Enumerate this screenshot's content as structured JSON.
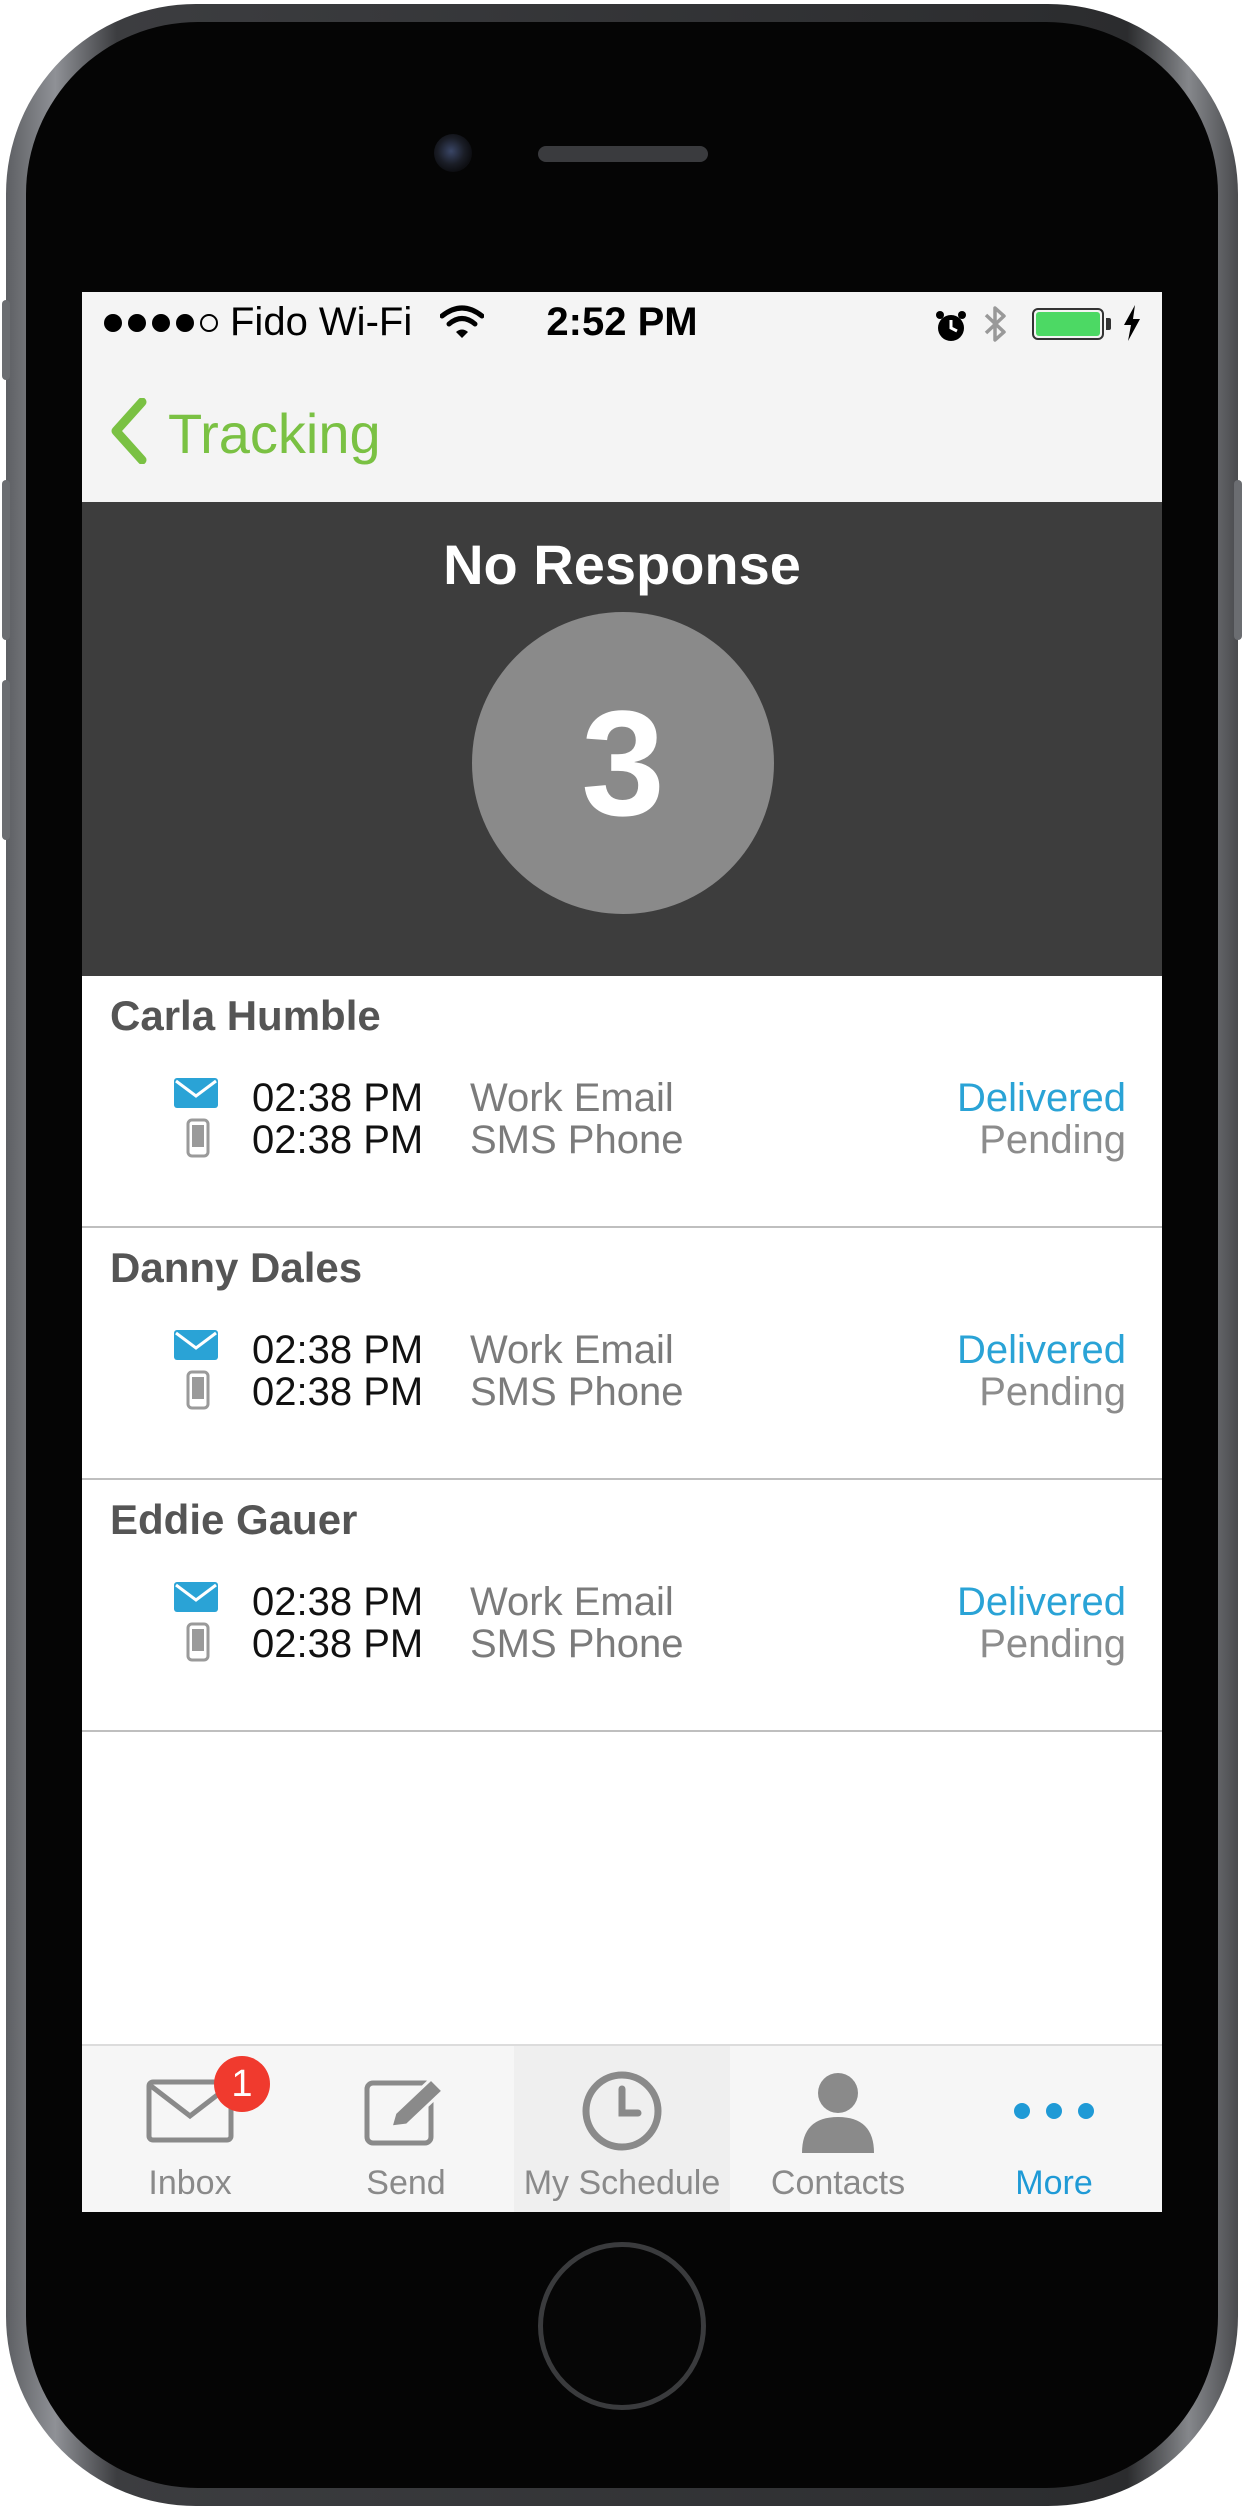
{
  "status_bar": {
    "carrier": "Fido Wi-Fi",
    "time": "2:52 PM",
    "signal_icon": "signal-dots-icon",
    "wifi_icon": "wifi-icon",
    "alarm_icon": "alarm-icon",
    "bluetooth_icon": "bluetooth-icon",
    "battery_icon": "battery-icon",
    "battery_level": 1.0,
    "battery_color": "#4cd964"
  },
  "nav": {
    "back_label": "Tracking",
    "back_icon": "chevron-left-icon",
    "accent_color": "#7ac143"
  },
  "summary": {
    "title": "No Response",
    "count": "3"
  },
  "contacts": [
    {
      "name": "Carla Humble",
      "rows": [
        {
          "icon": "envelope-icon",
          "time": "02:38 PM",
          "type": "Work Email",
          "status": "Delivered"
        },
        {
          "icon": "mobile-phone-icon",
          "time": "02:38 PM",
          "type": "SMS Phone",
          "status": "Pending"
        }
      ]
    },
    {
      "name": "Danny Dales",
      "rows": [
        {
          "icon": "envelope-icon",
          "time": "02:38 PM",
          "type": "Work Email",
          "status": "Delivered"
        },
        {
          "icon": "mobile-phone-icon",
          "time": "02:38 PM",
          "type": "SMS Phone",
          "status": "Pending"
        }
      ]
    },
    {
      "name": "Eddie Gauer",
      "rows": [
        {
          "icon": "envelope-icon",
          "time": "02:38 PM",
          "type": "Work Email",
          "status": "Delivered"
        },
        {
          "icon": "mobile-phone-icon",
          "time": "02:38 PM",
          "type": "SMS Phone",
          "status": "Pending"
        }
      ]
    }
  ],
  "tabs": [
    {
      "label": "Inbox",
      "icon": "inbox-envelope-icon",
      "badge": "1"
    },
    {
      "label": "Send",
      "icon": "compose-icon"
    },
    {
      "label": "My Schedule",
      "icon": "clock-icon"
    },
    {
      "label": "Contacts",
      "icon": "person-icon"
    },
    {
      "label": "More",
      "icon": "more-dots-icon",
      "active": true
    }
  ],
  "colors": {
    "delivered": "#2aa3d6",
    "pending": "#8c8c8c",
    "hero_bg": "#3d3d3d",
    "active_tab": "#1f9ad6",
    "badge": "#f03a2e"
  }
}
